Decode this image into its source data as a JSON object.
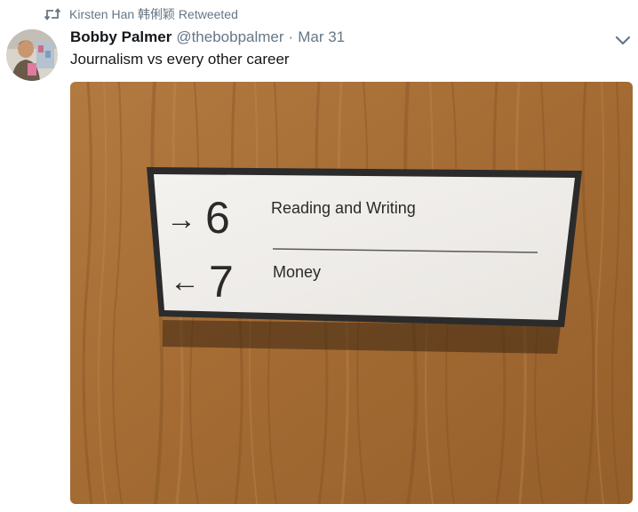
{
  "retweet": {
    "icon": "retweet-icon",
    "label": "Kirsten Han 韩俐颖 Retweeted"
  },
  "tweet": {
    "author_name": "Bobby Palmer",
    "author_handle": "@thebobpalmer",
    "separator": "·",
    "date": "Mar 31",
    "text": "Journalism vs every other career",
    "more_icon": "chevron-down-icon"
  },
  "photo": {
    "sign": {
      "row1_arrow": "→",
      "row1_number": "6",
      "row1_label": "Reading and Writing",
      "row2_arrow": "←",
      "row2_number": "7",
      "row2_label": "Money"
    }
  },
  "colors": {
    "secondary_text": "#657786",
    "primary_text": "#14171a",
    "wood": "#a86e35",
    "sign_face": "#f1efec",
    "sign_frame": "#2b2b2b"
  }
}
